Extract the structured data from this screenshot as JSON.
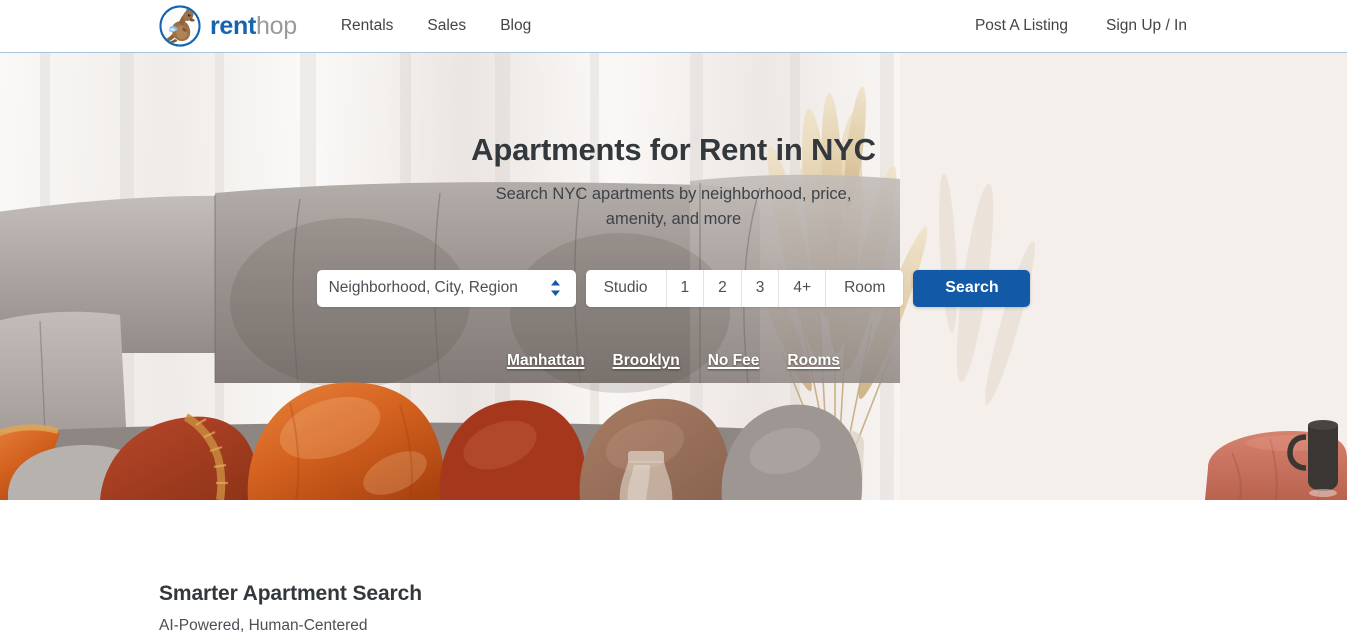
{
  "header": {
    "logo": {
      "icon": "renthop-kangaroo-logo-icon",
      "word_primary": "rent",
      "word_secondary": "hop"
    },
    "nav": [
      {
        "label": "Rentals",
        "name": "nav-rentals"
      },
      {
        "label": "Sales",
        "name": "nav-sales"
      },
      {
        "label": "Blog",
        "name": "nav-blog"
      }
    ],
    "account": [
      {
        "label": "Post A Listing",
        "name": "nav-post-a-listing"
      },
      {
        "label": "Sign Up / In",
        "name": "nav-sign-up-in"
      }
    ]
  },
  "hero": {
    "title": "Apartments for Rent in NYC",
    "subtitle": "Search NYC apartments by neighborhood, price, amenity, and more",
    "search": {
      "location_value": "Neighborhood, City, Region",
      "location_placeholder": "Neighborhood, City, Region",
      "caret_icon": "chevron-up-down-icon",
      "bedrooms": [
        {
          "label": "Studio"
        },
        {
          "label": "1"
        },
        {
          "label": "2"
        },
        {
          "label": "3"
        },
        {
          "label": "4+"
        },
        {
          "label": "Room"
        }
      ],
      "submit_label": "Search",
      "submit_color": "#1259a8"
    },
    "quick_links": [
      {
        "label": "Manhattan",
        "name": "quick-link-manhattan"
      },
      {
        "label": "Brooklyn",
        "name": "quick-link-brooklyn"
      },
      {
        "label": "No Fee",
        "name": "quick-link-no-fee"
      },
      {
        "label": "Rooms",
        "name": "quick-link-rooms"
      }
    ]
  },
  "below_fold": {
    "heading": "Smarter Apartment Search",
    "subheading": "AI-Powered, Human-Centered"
  },
  "theme": {
    "brand_blue": "#1664b0",
    "button_blue": "#1259a8",
    "text_dark": "#33383d",
    "text_body": "#4a5056",
    "header_border": "#a9c4dd"
  }
}
